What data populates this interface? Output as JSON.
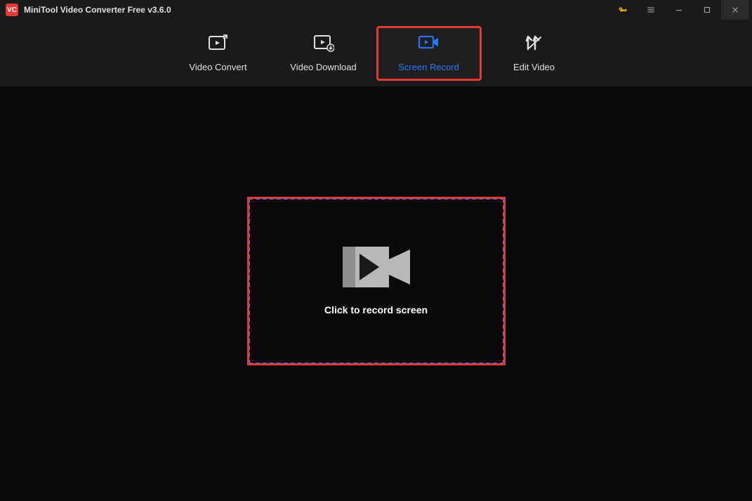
{
  "app": {
    "title": "MiniTool Video Converter Free v3.6.0",
    "logo_text": "VC"
  },
  "nav": {
    "tabs": [
      {
        "label": "Video Convert"
      },
      {
        "label": "Video Download"
      },
      {
        "label": "Screen Record"
      },
      {
        "label": "Edit Video"
      }
    ]
  },
  "main": {
    "record_prompt": "Click to record screen"
  }
}
